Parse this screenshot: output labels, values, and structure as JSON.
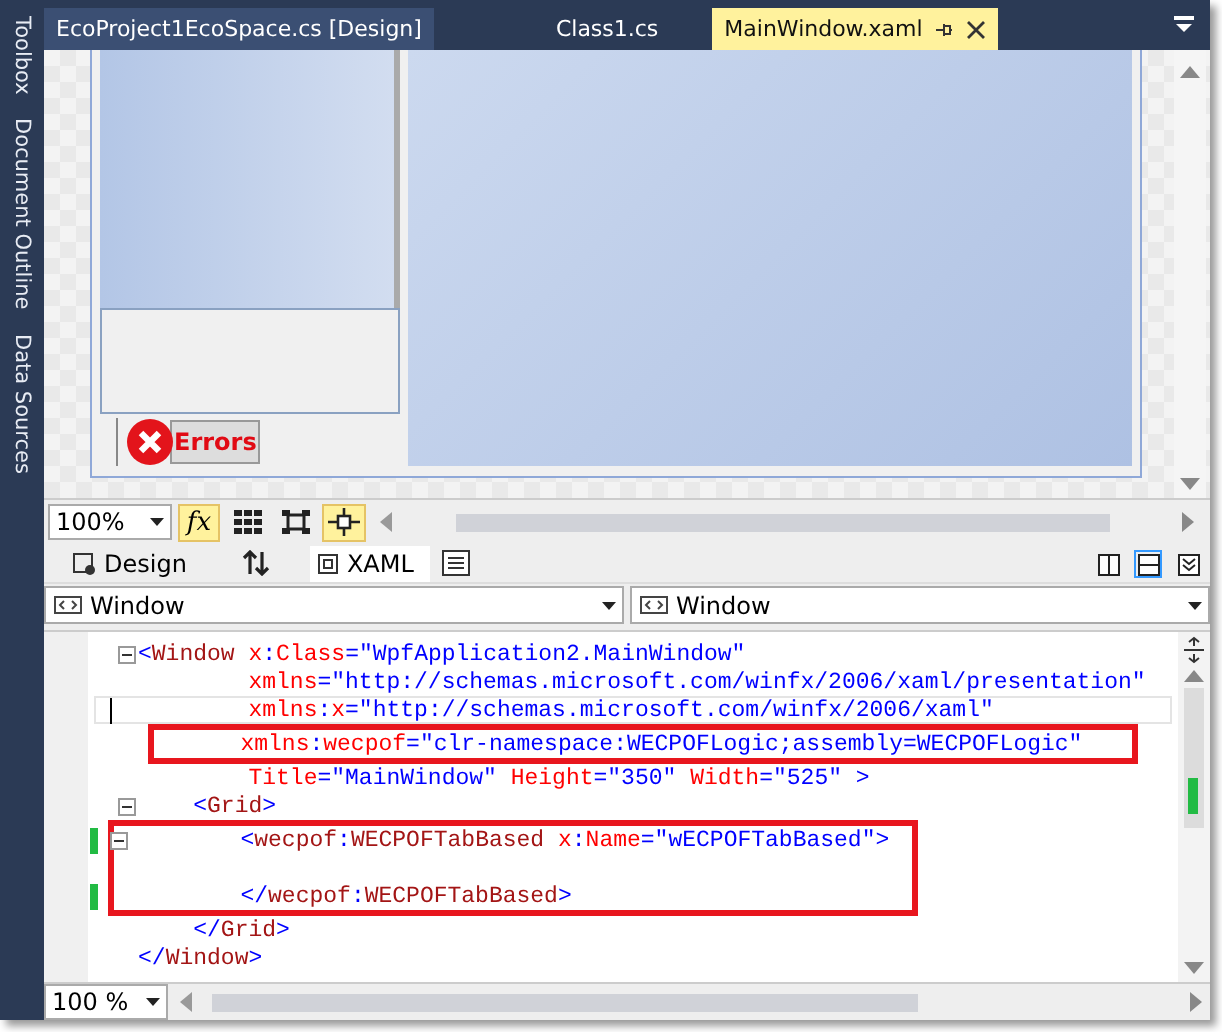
{
  "side_panel": {
    "items": [
      {
        "label": "Toolbox"
      },
      {
        "label": "Document Outline"
      },
      {
        "label": "Data Sources"
      }
    ]
  },
  "doc_tabs": [
    {
      "label": "EcoProject1EcoSpace.cs [Design]",
      "selected": false
    },
    {
      "label": "Class1.cs",
      "selected": false
    },
    {
      "label": "MainWindow.xaml",
      "selected": true
    }
  ],
  "designer": {
    "errors_button": "Errors"
  },
  "designer_toolbar": {
    "zoom": "100%",
    "buttons": [
      {
        "kind": "formula",
        "label": "fx",
        "selected": true
      },
      {
        "kind": "grid",
        "selected": false
      },
      {
        "kind": "snap-grid",
        "selected": false
      },
      {
        "kind": "snap-lines",
        "selected": true
      }
    ]
  },
  "view_tabs": [
    {
      "label": "Design",
      "selected": false
    },
    {
      "label": "XAML",
      "selected": true
    }
  ],
  "split_buttons": [
    {
      "kind": "vertical",
      "selected": false
    },
    {
      "kind": "horizontal",
      "selected": true
    },
    {
      "kind": "collapse",
      "selected": false
    }
  ],
  "navigation": {
    "left": "Window",
    "right": "Window"
  },
  "code": {
    "blocks": [
      {
        "highlighted": false,
        "lines": [
          {
            "kind": "code",
            "fold": true,
            "changed": false,
            "current": false,
            "segments": [
              {
                "kind": "punct",
                "text": "<"
              },
              {
                "kind": "element",
                "text": "Window"
              },
              {
                "kind": "attr",
                "text": " x"
              },
              {
                "kind": "punct",
                "text": ":"
              },
              {
                "kind": "attr",
                "text": "Class"
              },
              {
                "kind": "value",
                "text": "=\"WpfApplication2.MainWindow\""
              }
            ]
          },
          {
            "kind": "code",
            "fold": false,
            "changed": false,
            "current": false,
            "segments": [
              {
                "kind": "attr",
                "text": "        xmlns"
              },
              {
                "kind": "value",
                "text": "=\"http://schemas.microsoft.com/winfx/2006/xaml/presentation\""
              }
            ]
          },
          {
            "kind": "code",
            "fold": false,
            "changed": false,
            "current": true,
            "segments": [
              {
                "kind": "attr",
                "text": "        xmlns"
              },
              {
                "kind": "punct",
                "text": ":"
              },
              {
                "kind": "attr",
                "text": "x"
              },
              {
                "kind": "value",
                "text": "=\"http://schemas.microsoft.com/winfx/2006/xaml\""
              }
            ]
          }
        ]
      },
      {
        "highlighted": true,
        "lines": [
          {
            "kind": "code",
            "fold": false,
            "changed": false,
            "current": false,
            "segments": [
              {
                "kind": "attr",
                "text": "        xmlns"
              },
              {
                "kind": "punct",
                "text": ":"
              },
              {
                "kind": "attr",
                "text": "wecpof"
              },
              {
                "kind": "value",
                "text": "=\"clr-namespace:WECPOFLogic;assembly=WECPOFLogic\""
              }
            ]
          }
        ]
      },
      {
        "highlighted": false,
        "lines": [
          {
            "kind": "code",
            "fold": false,
            "changed": false,
            "current": false,
            "segments": [
              {
                "kind": "attr",
                "text": "        Title"
              },
              {
                "kind": "value",
                "text": "=\"MainWindow\""
              },
              {
                "kind": "attr",
                "text": " Height"
              },
              {
                "kind": "value",
                "text": "=\"350\""
              },
              {
                "kind": "attr",
                "text": " Width"
              },
              {
                "kind": "value",
                "text": "=\"525\" >"
              }
            ]
          },
          {
            "kind": "code",
            "fold": true,
            "changed": false,
            "current": false,
            "segments": [
              {
                "kind": "punct",
                "text": "    <"
              },
              {
                "kind": "element",
                "text": "Grid"
              },
              {
                "kind": "punct",
                "text": ">"
              }
            ]
          }
        ]
      },
      {
        "highlighted": true,
        "lines": [
          {
            "kind": "code",
            "fold": true,
            "changed": true,
            "current": false,
            "segments": [
              {
                "kind": "punct",
                "text": "        <"
              },
              {
                "kind": "element",
                "text": "wecpof"
              },
              {
                "kind": "punct",
                "text": ":"
              },
              {
                "kind": "element",
                "text": "WECPOFTabBased"
              },
              {
                "kind": "attr",
                "text": " x"
              },
              {
                "kind": "punct",
                "text": ":"
              },
              {
                "kind": "attr",
                "text": "Name"
              },
              {
                "kind": "value",
                "text": "=\"wECPOFTabBased\">"
              }
            ]
          },
          {
            "kind": "blank"
          },
          {
            "kind": "code",
            "fold": false,
            "changed": true,
            "current": false,
            "segments": [
              {
                "kind": "punct",
                "text": "        </"
              },
              {
                "kind": "element",
                "text": "wecpof"
              },
              {
                "kind": "punct",
                "text": ":"
              },
              {
                "kind": "element",
                "text": "WECPOFTabBased"
              },
              {
                "kind": "punct",
                "text": ">"
              }
            ]
          }
        ]
      },
      {
        "highlighted": false,
        "lines": [
          {
            "kind": "code",
            "fold": false,
            "changed": false,
            "current": false,
            "segments": [
              {
                "kind": "punct",
                "text": "    </"
              },
              {
                "kind": "element",
                "text": "Grid"
              },
              {
                "kind": "punct",
                "text": ">"
              }
            ]
          },
          {
            "kind": "code",
            "fold": false,
            "changed": false,
            "current": false,
            "segments": [
              {
                "kind": "punct",
                "text": "</"
              },
              {
                "kind": "element",
                "text": "Window"
              },
              {
                "kind": "punct",
                "text": ">"
              }
            ]
          }
        ]
      }
    ]
  },
  "editor_zoom": "100 %"
}
